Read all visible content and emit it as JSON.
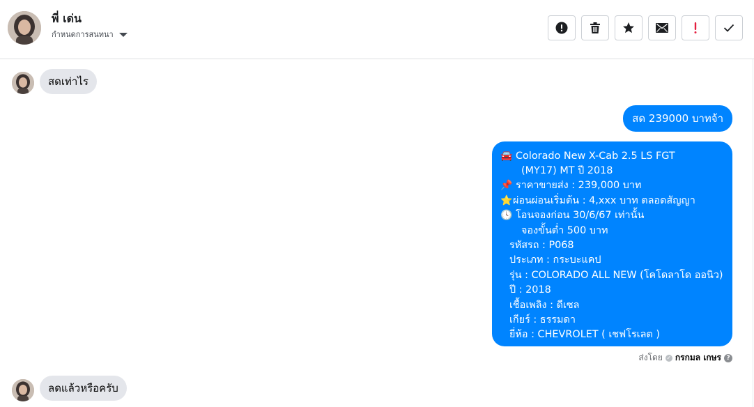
{
  "header": {
    "contact_name": "พี่ เด่น",
    "customize_label": "กำหนดการสนทนา",
    "actions": [
      {
        "icon": "exclamation-circle-icon",
        "name": "report-button"
      },
      {
        "icon": "trash-icon",
        "name": "delete-button"
      },
      {
        "icon": "star-icon",
        "name": "star-button"
      },
      {
        "icon": "envelope-icon",
        "name": "mark-unread-button"
      },
      {
        "icon": "exclamation-mark-icon",
        "name": "follow-up-button"
      },
      {
        "icon": "checkmark-icon",
        "name": "mark-done-button"
      }
    ]
  },
  "messages": {
    "incoming_1": "สดเท่าไร",
    "outgoing_price": "สด 239000 บาทจ้า",
    "detail": {
      "line1": "Colorado New X-Cab 2.5 LS FGT",
      "line2": "(MY17) MT ปี 2018",
      "line3": "ราคาขายส่ง : 239,000 บาท",
      "line4": "ผ่อนผ่อนเริ่มต้น : 4,xxx บาท ตลอดสัญญา",
      "line5": "โอนจองก่อน 30/6/67 เท่านั้น",
      "line6": "จองขั้นต่ำ 500 บาท",
      "line7": "รหัสรถ : P068",
      "line8": "ประเภท : กระบะแคป",
      "line9": "รุ่น : COLORADO ALL NEW (โคโดลาโด ออนิว)",
      "line10": "ปี : 2018",
      "line11": "เชื้อเพลิง : ดีเซล",
      "line12": "เกียร์ : ธรรมดา",
      "line13": "ยี่ห้อ : CHEVROLET ( เชฟโรเลต )",
      "icons": [
        "car-emoji-icon",
        "pushpin-emoji-icon",
        "star-emoji-icon",
        "clock-emoji-icon"
      ]
    },
    "sent_by_label": "ส่งโดย",
    "sent_by_name": "กรกมล เกษร",
    "incoming_2": "ลดแล้วหรือครับ"
  },
  "colors": {
    "outgoing_bubble": "#0084ff",
    "incoming_bubble": "#e4e6eb",
    "follow_up_red": "#e41e3f"
  }
}
